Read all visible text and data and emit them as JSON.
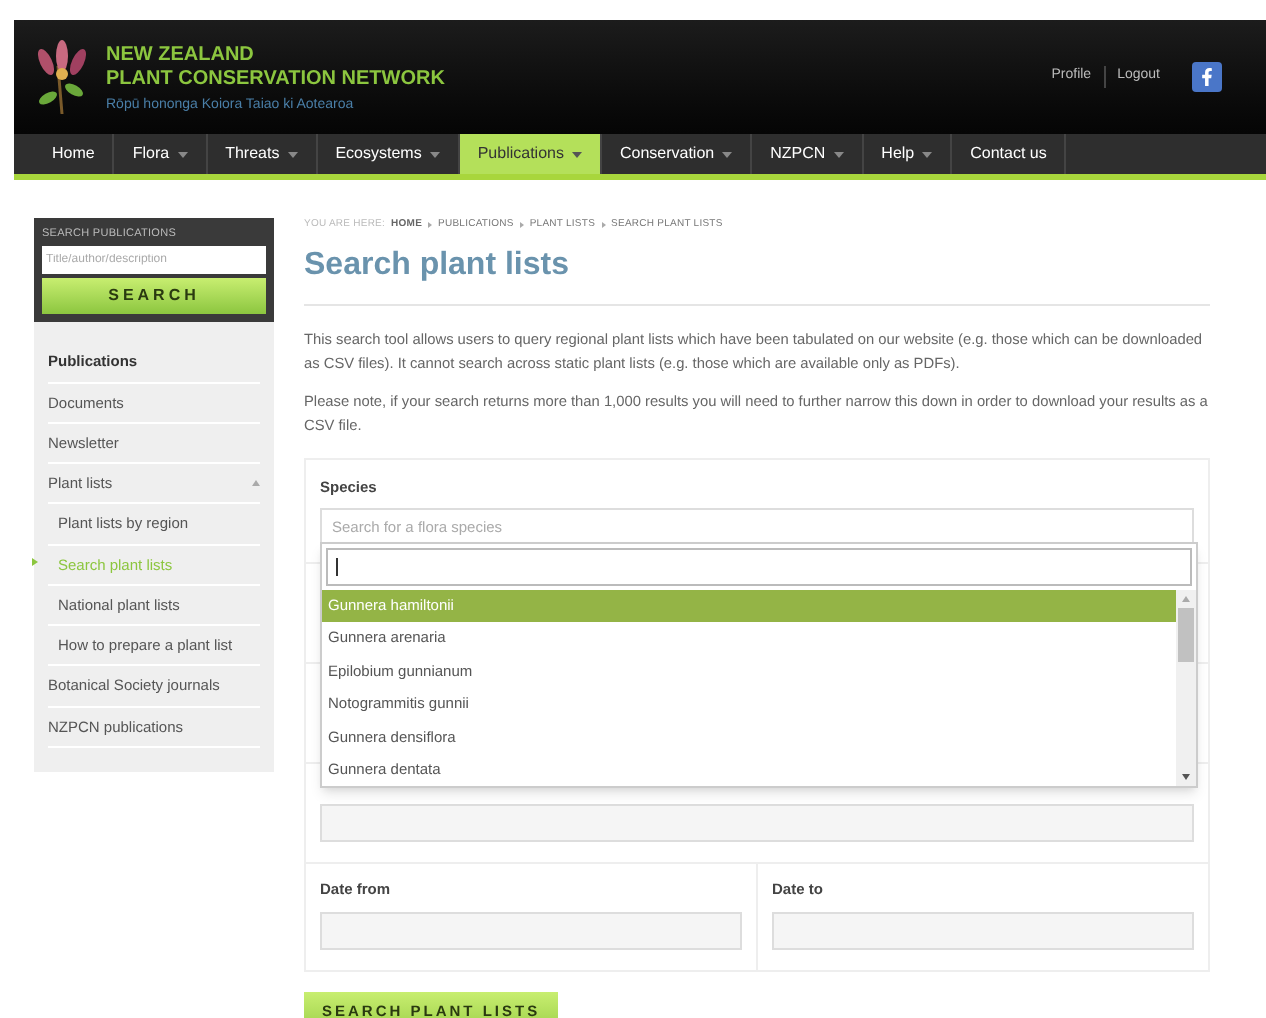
{
  "header": {
    "title_line1": "NEW ZEALAND",
    "title_line2": "PLANT CONSERVATION NETWORK",
    "subtitle": "Rōpū hononga Koiora Taiao ki Aotearoa",
    "links": [
      "Profile",
      "Logout"
    ]
  },
  "nav": [
    {
      "label": "Home",
      "has_caret": false,
      "selected": false
    },
    {
      "label": "Flora",
      "has_caret": true,
      "selected": false
    },
    {
      "label": "Threats",
      "has_caret": true,
      "selected": false
    },
    {
      "label": "Ecosystems",
      "has_caret": true,
      "selected": false
    },
    {
      "label": "Publications",
      "has_caret": true,
      "selected": true
    },
    {
      "label": "Conservation",
      "has_caret": true,
      "selected": false
    },
    {
      "label": "NZPCN",
      "has_caret": true,
      "selected": false
    },
    {
      "label": "Help",
      "has_caret": true,
      "selected": false
    },
    {
      "label": "Contact us",
      "has_caret": false,
      "selected": false
    }
  ],
  "sidebar": {
    "search_label": "SEARCH PUBLICATIONS",
    "search_placeholder": "Title/author/description",
    "search_button": "SEARCH",
    "heading": "Publications",
    "items": [
      {
        "label": "Documents",
        "selected": false
      },
      {
        "label": "Newsletter",
        "selected": false
      },
      {
        "label": "Plant lists",
        "selected": false,
        "expanded": true,
        "children": [
          {
            "label": "Plant lists by region",
            "selected": false
          },
          {
            "label": "Search plant lists",
            "selected": true
          },
          {
            "label": "National plant lists",
            "selected": false
          },
          {
            "label": "How to prepare a plant list",
            "selected": false
          }
        ]
      },
      {
        "label": "Botanical Society journals",
        "selected": false
      },
      {
        "label": "NZPCN publications",
        "selected": false
      }
    ]
  },
  "breadcrumb": {
    "prefix": "YOU ARE HERE:",
    "items": [
      "HOME",
      "PUBLICATIONS",
      "PLANT LISTS",
      "SEARCH PLANT LISTS"
    ]
  },
  "title": "Search plant lists",
  "paragraphs": [
    "This search tool allows users to query regional plant lists which have been tabulated on our website (e.g. those which can be downloaded as CSV files). It cannot search across static plant lists (e.g. those which are available only as PDFs).",
    "Please note, if your search returns more than 1,000 results you will need to further narrow this down in order to download your results as a CSV file."
  ],
  "form": {
    "species_label": "Species",
    "species_placeholder": "Search for a flora species",
    "dropdown": [
      {
        "label": "Gunnera hamiltonii",
        "selected": true
      },
      {
        "label": "Gunnera arenaria",
        "selected": false
      },
      {
        "label": "Epilobium gunnianum",
        "selected": false
      },
      {
        "label": "Notogrammitis gunnii",
        "selected": false
      },
      {
        "label": "Gunnera densiflora",
        "selected": false
      },
      {
        "label": "Gunnera dentata",
        "selected": false
      }
    ],
    "date_from_label": "Date from",
    "date_to_label": "Date to",
    "submit": "SEARCH PLANT LISTS"
  }
}
